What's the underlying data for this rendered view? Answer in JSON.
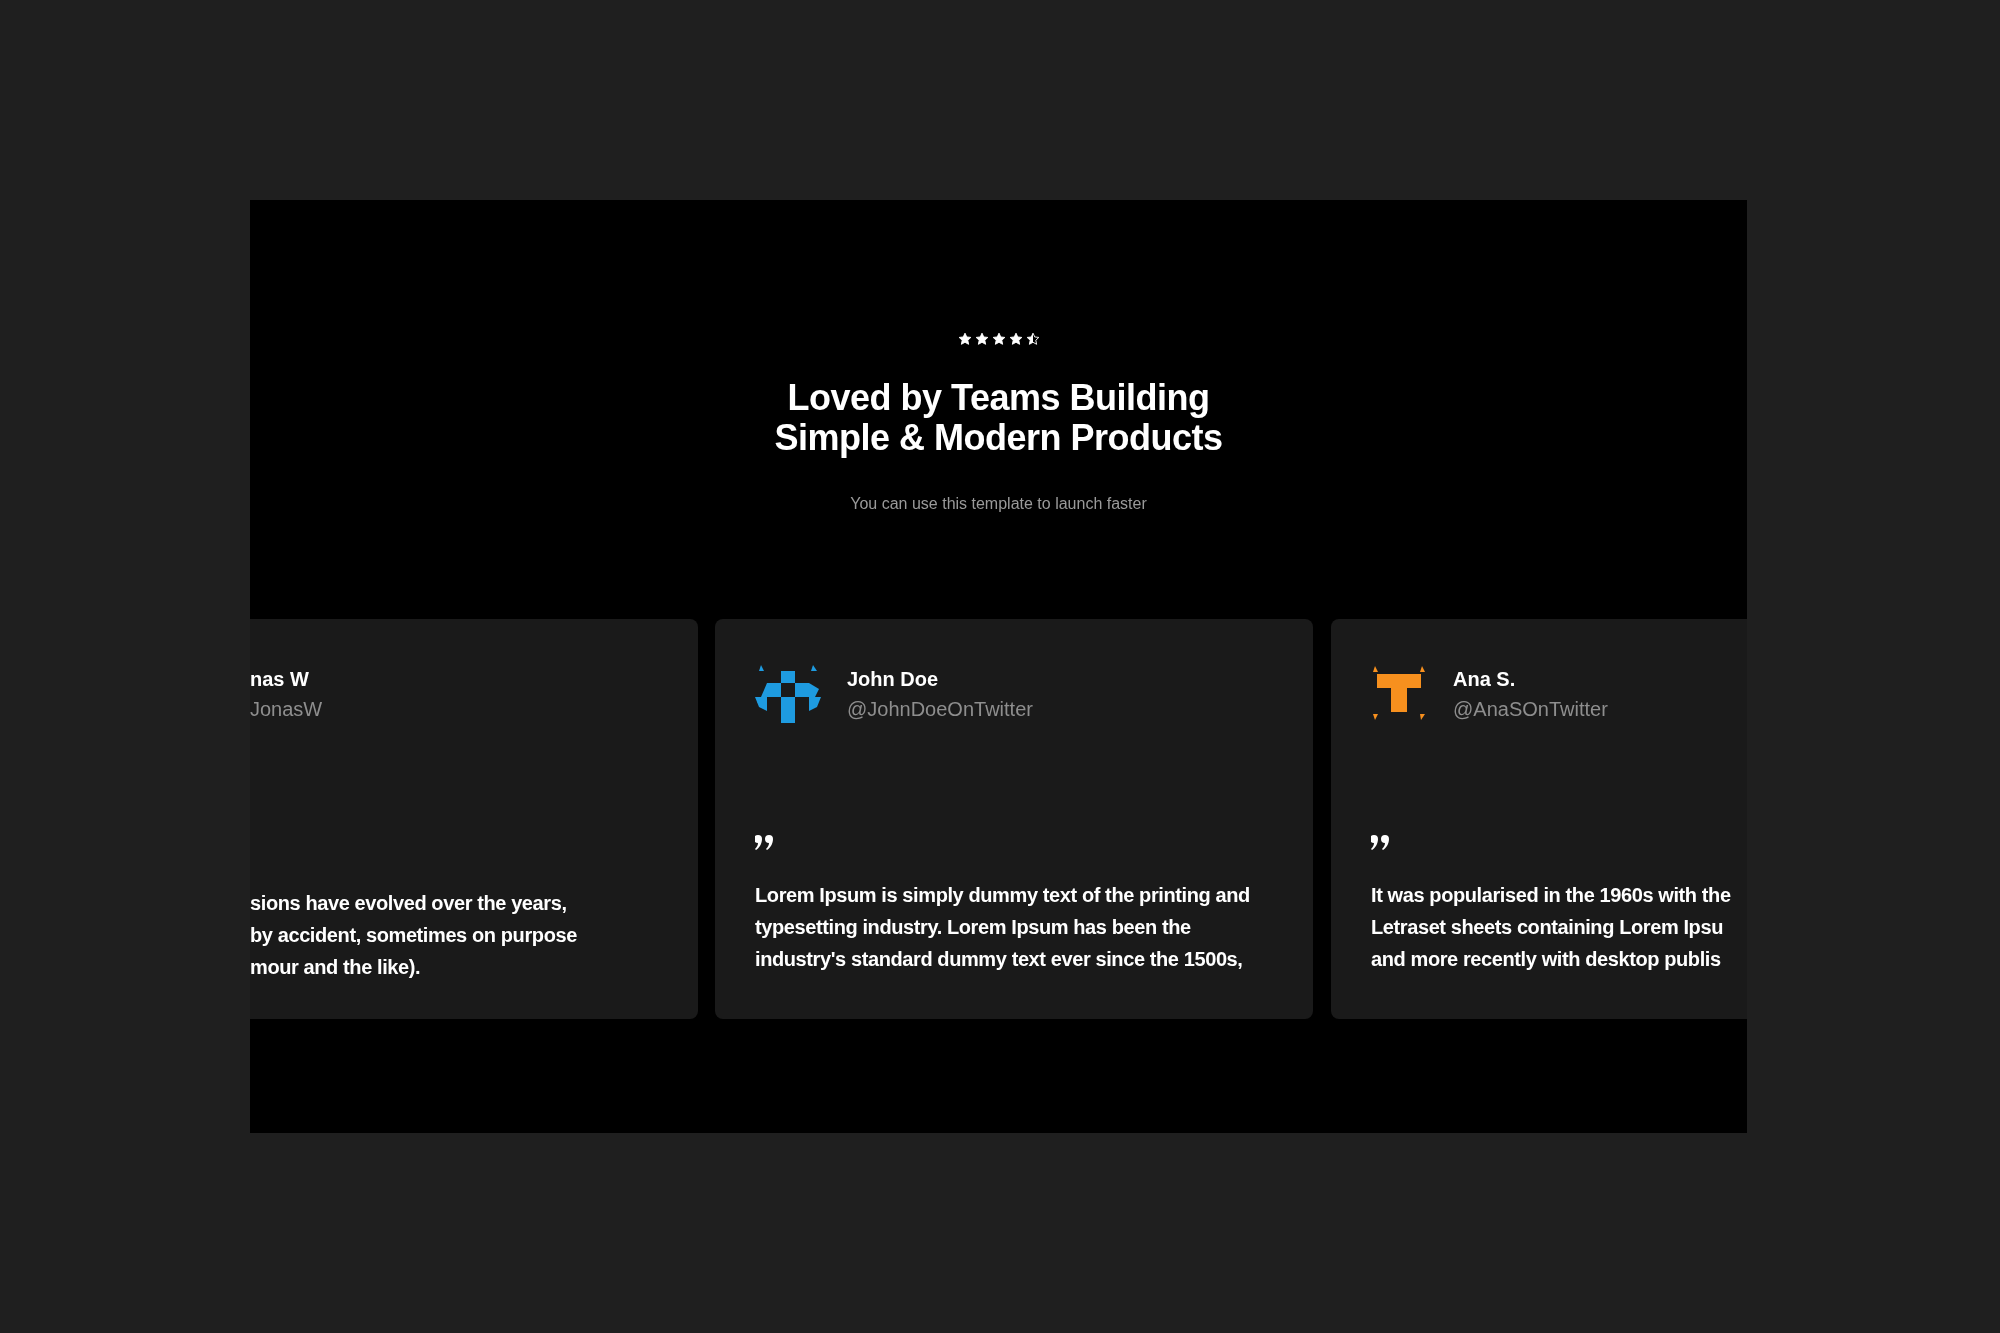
{
  "rating": {
    "stars": 4.5
  },
  "heading": [
    "Loved by Teams Building",
    "Simple & Modern Products"
  ],
  "subtitle": "You can use this template to launch faster",
  "testimonials": [
    {
      "kind": "none",
      "name": "nas W",
      "handle": "JonasW",
      "lines": [
        "sions have evolved over the years,",
        "by accident, sometimes on purpose",
        "mour and the like)."
      ]
    },
    {
      "kind": "blocks",
      "name": "John Doe",
      "handle": "@JohnDoeOnTwitter",
      "lines": [
        "Lorem Ipsum is simply dummy text of the printing and",
        "typesetting industry. Lorem Ipsum has been the",
        "industry's standard dummy text ever since the 1500s,"
      ]
    },
    {
      "kind": "letter",
      "name": "Ana S.",
      "handle": "@AnaSOnTwitter",
      "lines": [
        "It was popularised in the 1960s with the",
        "Letraset sheets containing Lorem Ipsu",
        "and more recently with desktop publis"
      ]
    }
  ]
}
